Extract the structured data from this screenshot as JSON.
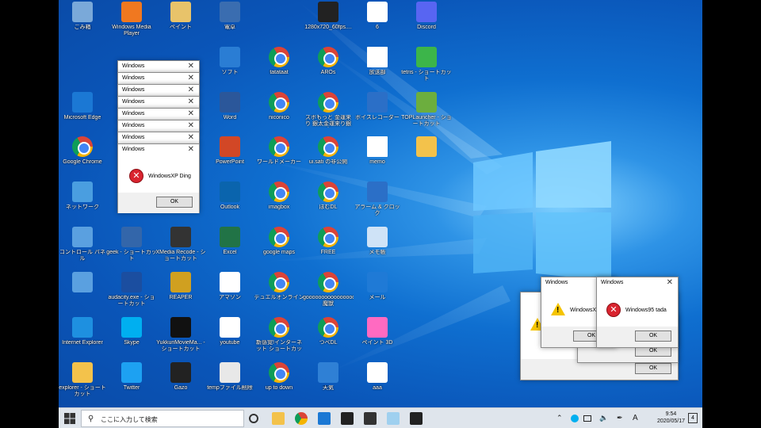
{
  "taskbar": {
    "search_placeholder": "ここに入力して検索",
    "time": "9:54",
    "date": "2020/05/17",
    "ime_label": "A",
    "notification_count": "4"
  },
  "desktop_icons": [
    {
      "label": "ごみ箱",
      "icon": "recycle-bin-icon",
      "color": "#7aa9d9"
    },
    {
      "label": "Windows Media Player",
      "icon": "media-player-icon",
      "color": "#f07820"
    },
    {
      "label": "ペイント",
      "icon": "paint-icon",
      "color": "#e8c36a"
    },
    {
      "label": "電卓",
      "icon": "calculator-icon",
      "color": "#3a6db0"
    },
    {
      "label": "1280x720_60fps....",
      "icon": "video-file-icon",
      "color": "#222222"
    },
    {
      "label": "6",
      "icon": "script-file-icon",
      "color": "#ffffff"
    },
    {
      "label": "Discord",
      "icon": "discord-icon",
      "color": "#5865f2"
    },
    {
      "label": "ソフト",
      "icon": "folder-app-icon",
      "color": "#2a7dd4"
    },
    {
      "label": "tatataat",
      "icon": "chrome-icon",
      "color": "chrome"
    },
    {
      "label": "AROs",
      "icon": "chrome-icon",
      "color": "chrome"
    },
    {
      "label": "放送部",
      "icon": "document-icon",
      "color": "doc"
    },
    {
      "label": "tetris - ショートカット",
      "icon": "tetris-icon",
      "color": "#3cb54a"
    },
    {
      "label": "Microsoft Edge",
      "icon": "edge-icon",
      "color": "#1b78d4"
    },
    {
      "label": "Word",
      "icon": "word-icon",
      "color": "#2b579a"
    },
    {
      "label": "niconico",
      "icon": "chrome-icon",
      "color": "chrome"
    },
    {
      "label": "ズボもっと 金運来り 銀太金運来り銀太",
      "icon": "chrome-icon",
      "color": "chrome"
    },
    {
      "label": "ボイスレコーダー",
      "icon": "voice-recorder-icon",
      "color": "#2b6fc7"
    },
    {
      "label": "TOPLauncher - ショートカット",
      "icon": "toplauncher-icon",
      "color": "#6cae3e"
    },
    {
      "label": "Google Chrome",
      "icon": "chrome-icon",
      "color": "chrome"
    },
    {
      "label": "PowerPoint",
      "icon": "powerpoint-icon",
      "color": "#d24726"
    },
    {
      "label": "ワールドメーカー",
      "icon": "chrome-icon",
      "color": "chrome"
    },
    {
      "label": "ui.sati の非公開",
      "icon": "chrome-icon",
      "color": "chrome"
    },
    {
      "label": "memo",
      "icon": "document-icon",
      "color": "doc"
    },
    {
      "label": "",
      "icon": "folder-icon",
      "color": "#f3c24b"
    },
    {
      "label": "ネットワーク",
      "icon": "network-icon",
      "color": "#4a9ee0"
    },
    {
      "label": "Outlook",
      "icon": "outlook-icon",
      "color": "#0a64ad"
    },
    {
      "label": "imagbox",
      "icon": "chrome-icon",
      "color": "chrome"
    },
    {
      "label": "ぽむDL",
      "icon": "chrome-icon",
      "color": "chrome"
    },
    {
      "label": "アラーム & クロック",
      "icon": "alarm-clock-icon",
      "color": "#2b6fc7"
    },
    {
      "label": "コントロール パネル",
      "icon": "control-panel-icon",
      "color": "#5aa0e0"
    },
    {
      "label": "geek - ショートカット",
      "icon": "geek-icon",
      "color": "#3366aa"
    },
    {
      "label": "XMedia Recode - ショートカット",
      "icon": "xmedia-recode-icon",
      "color": "#333333"
    },
    {
      "label": "Excel",
      "icon": "excel-icon",
      "color": "#217346"
    },
    {
      "label": "google maps",
      "icon": "chrome-icon",
      "color": "chrome"
    },
    {
      "label": "FREE",
      "icon": "chrome-icon",
      "color": "chrome"
    },
    {
      "label": "メモ帳",
      "icon": "notepad-icon",
      "color": "#cfe3f7"
    },
    {
      "label": "",
      "icon": "control-panel-icon",
      "color": "#5aa0e0"
    },
    {
      "label": "audacity.exe - ショートカット",
      "icon": "audacity-icon",
      "color": "#1b4ea0"
    },
    {
      "label": "REAPER",
      "icon": "reaper-icon",
      "color": "#d0a020"
    },
    {
      "label": "アマゾン",
      "icon": "amazon-icon",
      "color": "#ffffff"
    },
    {
      "label": "デュエルオンライン",
      "icon": "chrome-icon",
      "color": "chrome"
    },
    {
      "label": "goooooooooooooooogle 魔獣",
      "icon": "chrome-icon",
      "color": "chrome"
    },
    {
      "label": "メール",
      "icon": "mail-icon",
      "color": "#1f7ad6"
    },
    {
      "label": "Internet Explorer",
      "icon": "ie-icon",
      "color": "#1e90e0"
    },
    {
      "label": "Skype",
      "icon": "skype-icon",
      "color": "#00aff0"
    },
    {
      "label": "YukkuriMovieMa... - ショートカット",
      "icon": "yukkuri-icon",
      "color": "#111111"
    },
    {
      "label": "youtube",
      "icon": "youtube-icon",
      "color": "#ffffff"
    },
    {
      "label": "新感覚!インターネット ショートカット",
      "icon": "chrome-icon",
      "color": "chrome"
    },
    {
      "label": "つべDL",
      "icon": "chrome-icon",
      "color": "chrome"
    },
    {
      "label": "ペイント 3D",
      "icon": "paint-3d-icon",
      "color": "#ff6ac1"
    },
    {
      "label": "explorer - ショートカット",
      "icon": "explorer-icon",
      "color": "#f3c24b"
    },
    {
      "label": "Twitter",
      "icon": "twitter-icon",
      "color": "#1da1f2"
    },
    {
      "label": "Gazo",
      "icon": "gazo-icon",
      "color": "#222222"
    },
    {
      "label": "tempファイル削除",
      "icon": "settings-icon",
      "color": "#e8e8e8"
    },
    {
      "label": "up to down",
      "icon": "chrome-icon",
      "color": "chrome"
    },
    {
      "label": "天気",
      "icon": "weather-icon",
      "color": "#2f80d5"
    },
    {
      "label": "aaa",
      "icon": "script-file-icon",
      "color": "#ffffff"
    }
  ],
  "stack_dialogs": {
    "title": "Windows",
    "count_titles": [
      "Windows",
      "Windows",
      "Windows",
      "Windows",
      "Windows",
      "Windows",
      "Windows"
    ],
    "front_message": "WindowsXP Ding",
    "ok_label": "OK"
  },
  "right_dialogs": {
    "title_left": "Windows",
    "title_right": "Windows",
    "msg_left": "WindowsXP",
    "msg_right": "Windows95 tada",
    "ok_label": "OK"
  },
  "taskbar_apps": [
    {
      "icon": "task-view-icon"
    },
    {
      "icon": "file-explorer-icon"
    },
    {
      "icon": "chrome-taskbar-icon"
    },
    {
      "icon": "edge-taskbar-icon"
    },
    {
      "icon": "video-taskbar-icon"
    },
    {
      "icon": "gazo-taskbar-icon"
    },
    {
      "icon": "notepad-taskbar-icon"
    },
    {
      "icon": "movie-taskbar-icon"
    }
  ],
  "colors": {
    "error_red": "#d9242f",
    "warning_yellow": "#f5c400",
    "desktop_blue": "#0a55b8"
  }
}
